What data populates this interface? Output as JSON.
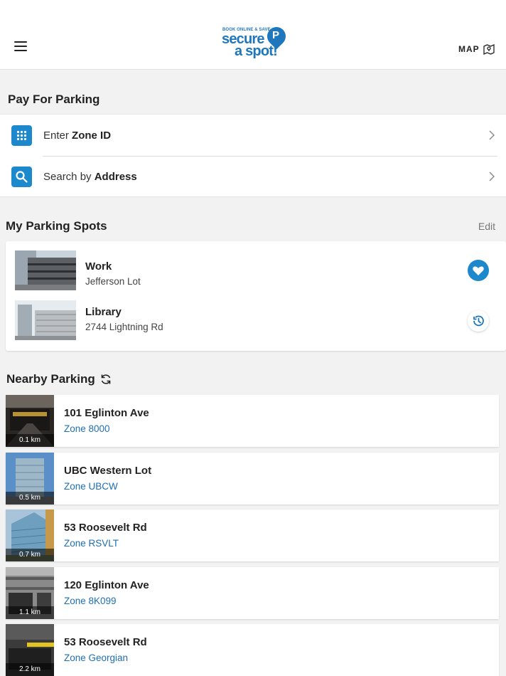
{
  "header": {
    "logo": {
      "tagline": "BOOK ONLINE & SAVE",
      "line1": "secure",
      "line2": "a spot!",
      "badge": "P"
    },
    "map_label": "MAP"
  },
  "pay": {
    "title": "Pay For Parking",
    "zone": {
      "prefix": "Enter ",
      "bold": "Zone ID"
    },
    "address": {
      "prefix": "Search by ",
      "bold": "Address"
    }
  },
  "spots": {
    "title": "My Parking Spots",
    "edit_label": "Edit",
    "items": [
      {
        "name": "Work",
        "sub": "Jefferson Lot",
        "action": "heart-icon"
      },
      {
        "name": "Library",
        "sub": "2744 Lightning Rd",
        "action": "history-icon"
      }
    ]
  },
  "nearby": {
    "title": "Nearby Parking",
    "items": [
      {
        "name": "101 Eglinton Ave",
        "zone": "Zone 8000",
        "dist": "0.1 km"
      },
      {
        "name": "UBC Western Lot",
        "zone": "Zone UBCW",
        "dist": "0.5 km"
      },
      {
        "name": "53 Roosevelt Rd",
        "zone": "Zone RSVLT",
        "dist": "0.7 km"
      },
      {
        "name": "120 Eglinton Ave",
        "zone": "Zone 8K099",
        "dist": "1.1 km"
      },
      {
        "name": "53 Roosevelt Rd",
        "zone": "Zone Georgian",
        "dist": "2.2 km"
      }
    ]
  },
  "colors": {
    "accent": "#1e88cc",
    "zone_text": "#1e6fb3",
    "background": "#f2f2f3"
  }
}
